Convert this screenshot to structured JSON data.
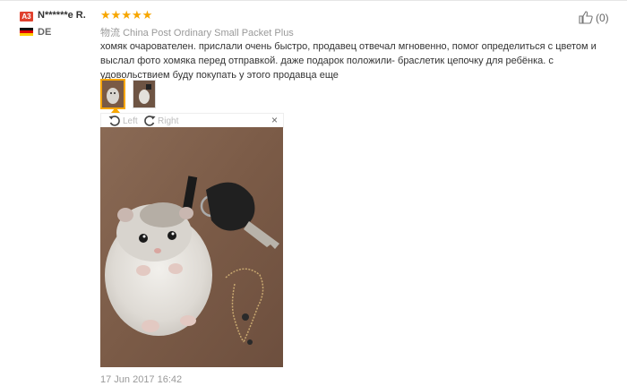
{
  "review": {
    "level_badge": "A3",
    "username": "N******e R.",
    "stars": [
      "★",
      "★",
      "★",
      "★",
      "★"
    ],
    "country_code": "DE",
    "shipping_label": "物流",
    "shipping_method": "China Post Ordinary Small Packet Plus",
    "text": "хомяк очарователен. прислали очень быстро, продавец отвечал мгновенно, помог определиться с цветом и выслал фото хомяка перед отправкой. даже подарок положили- браслетик цепочку для ребёнка. с удовольствием буду покупать у этого продавца еще",
    "helpful_count": "(0)",
    "date": "17 Jun 2017 16:42"
  },
  "viewer": {
    "rotate_left_label": "Left",
    "rotate_right_label": "Right",
    "close_symbol": "×"
  },
  "colors": {
    "badge": "#e0412e",
    "star": "#f7a600",
    "text_muted": "#999999"
  }
}
